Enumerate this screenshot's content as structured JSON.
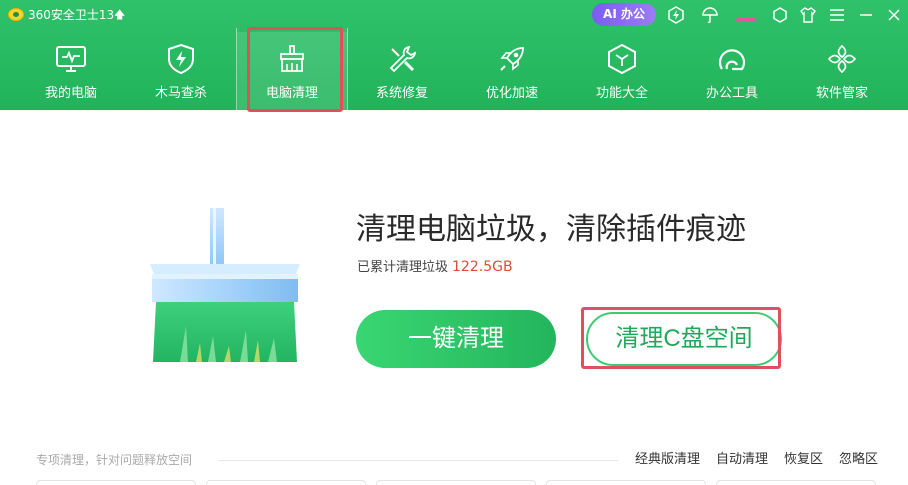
{
  "app": {
    "title": "360安全卫士13",
    "upgrade_icon": "up-arrow-icon"
  },
  "titlebar": {
    "ai_button": "AI 办公",
    "icons": [
      "lightning-icon",
      "umbrella-icon",
      "avatar-icon",
      "settings-icon",
      "shirt-icon",
      "menu-icon",
      "minimize-icon",
      "close-icon"
    ]
  },
  "nav": {
    "items": [
      {
        "label": "我的电脑",
        "icon": "monitor-icon"
      },
      {
        "label": "木马查杀",
        "icon": "shield-icon"
      },
      {
        "label": "电脑清理",
        "icon": "broom-icon"
      },
      {
        "label": "系统修复",
        "icon": "wrench-icon"
      },
      {
        "label": "优化加速",
        "icon": "rocket-icon"
      },
      {
        "label": "功能大全",
        "icon": "cube-icon"
      },
      {
        "label": "办公工具",
        "icon": "office-icon"
      },
      {
        "label": "软件管家",
        "icon": "apps-icon"
      }
    ],
    "active_index": 2
  },
  "main": {
    "title": "清理电脑垃圾，清除插件痕迹",
    "cleaned_label": "已累计清理垃圾",
    "cleaned_value": "122.5GB",
    "primary_button": "一键清理",
    "secondary_button": "清理C盘空间"
  },
  "bottom": {
    "hint": "专项清理，针对问题释放空间",
    "links": [
      "经典版清理",
      "自动清理",
      "恢复区",
      "忽略区"
    ]
  },
  "colors": {
    "brand_green": "#2fc26a",
    "highlight_red": "#e0505a",
    "value_red": "#e04b34",
    "ai_purple": "#8a6cf3"
  }
}
